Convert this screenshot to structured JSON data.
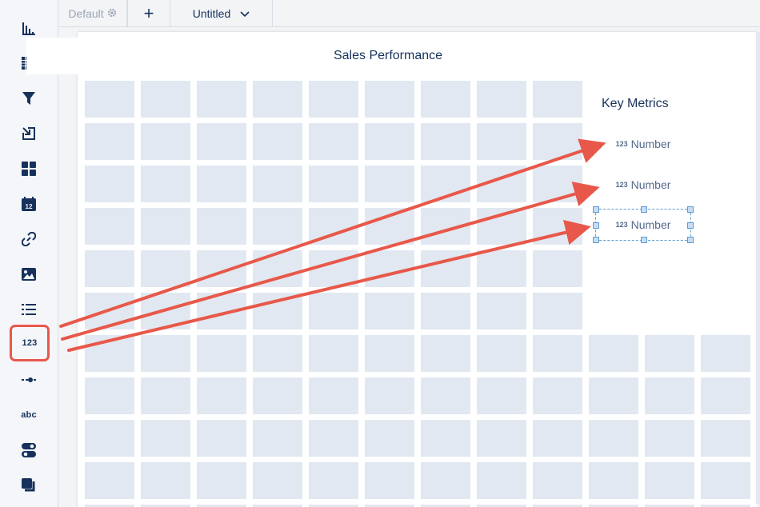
{
  "tabs": {
    "default_label": "Default",
    "add_label": "+",
    "page_label": "Untitled"
  },
  "toolbar": {
    "items": [
      {
        "name": "chart-icon"
      },
      {
        "name": "table-icon"
      },
      {
        "name": "filter-icon"
      },
      {
        "name": "link-widget-icon"
      },
      {
        "name": "container-icon"
      },
      {
        "name": "date-icon",
        "text": "12"
      },
      {
        "name": "link-icon"
      },
      {
        "name": "image-icon"
      },
      {
        "name": "list-icon"
      },
      {
        "name": "number-icon",
        "text": "123"
      },
      {
        "name": "range-icon"
      },
      {
        "name": "text-icon",
        "text": "abc"
      },
      {
        "name": "toggle-icon"
      },
      {
        "name": "layers-icon"
      }
    ]
  },
  "canvas": {
    "title": "Sales Performance",
    "panel_title": "Key Metrics",
    "number_widgets": [
      {
        "prefix": "123",
        "label": "Number"
      },
      {
        "prefix": "123",
        "label": "Number"
      },
      {
        "prefix": "123",
        "label": "Number"
      }
    ]
  },
  "colors": {
    "accent": "#e8584a",
    "grid_cell": "#e1e8f1",
    "selection": "#5a9bd5"
  }
}
